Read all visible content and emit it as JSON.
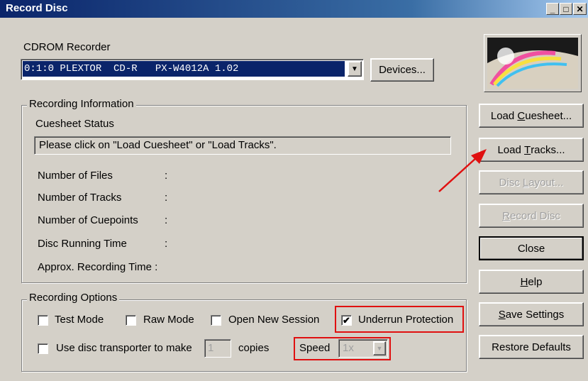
{
  "window": {
    "title": "Record Disc",
    "controls": {
      "minimize": "_",
      "maximize": "□",
      "close": "✕"
    }
  },
  "recorder": {
    "label": "CDROM Recorder",
    "selected": "0:1:0 PLEXTOR  CD-R   PX-W4012A 1.02",
    "devices_button": "Devices..."
  },
  "recording_info": {
    "title": "Recording Information",
    "cuesheet_status_label": "Cuesheet Status",
    "status_message": "Please click on \"Load Cuesheet\" or \"Load Tracks\".",
    "fields": [
      {
        "label": "Number of Files",
        "sep": ":"
      },
      {
        "label": "Number of Tracks",
        "sep": ":"
      },
      {
        "label": "Number of Cuepoints",
        "sep": ":"
      },
      {
        "label": "Disc Running Time",
        "sep": ":"
      },
      {
        "label": "Approx. Recording Time :",
        "sep": ""
      }
    ]
  },
  "options": {
    "title": "Recording Options",
    "test_mode": "Test Mode",
    "raw_mode": "Raw Mode",
    "open_new_session": "Open New Session",
    "underrun_protection": "Underrun Protection",
    "underrun_checked": true,
    "transporter": "Use disc transporter to make",
    "copies_value": "1",
    "copies": "copies",
    "speed_label": "Speed",
    "speed_value": "1x"
  },
  "buttons": {
    "load_cuesheet": {
      "pre": "Load ",
      "ul": "C",
      "post": "uesheet..."
    },
    "load_tracks": {
      "pre": "Load ",
      "ul": "T",
      "post": "racks..."
    },
    "disc_layout": {
      "pre": "Disc ",
      "ul": "L",
      "post": "ayout..."
    },
    "record_disc": {
      "pre": "",
      "ul": "R",
      "post": "ecord Disc"
    },
    "close": "Close",
    "help": {
      "pre": "",
      "ul": "H",
      "post": "elp"
    },
    "save_settings": {
      "pre": "",
      "ul": "S",
      "post": "ave Settings"
    },
    "restore_defaults": "Restore Defaults"
  },
  "colors": {
    "highlight": "#e01010",
    "selection": "#0a246a"
  }
}
